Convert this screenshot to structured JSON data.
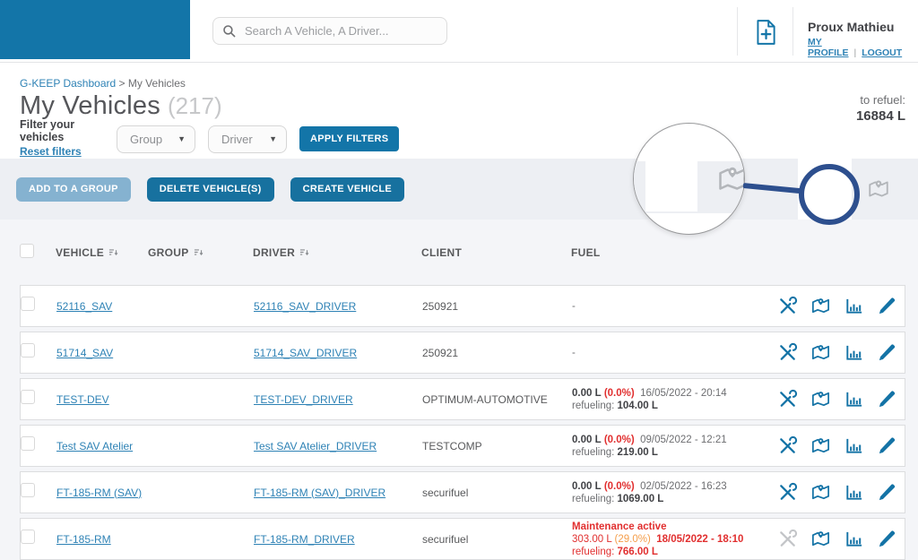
{
  "header": {
    "search_placeholder": "Search A Vehicle, A Driver...",
    "user_name": "Proux Mathieu",
    "my_profile": "MY PROFILE",
    "divider": "|",
    "logout": "LOGOUT"
  },
  "breadcrumb": {
    "home": "G-KEEP Dashboard",
    "rest": " > My Vehicles"
  },
  "page": {
    "title": "My Vehicles",
    "count": "(217)",
    "to_refuel_label": "to refuel:",
    "to_refuel_value": "16884 L"
  },
  "filters": {
    "label": "Filter your vehicles",
    "reset": "Reset filters",
    "group": "Group",
    "driver": "Driver",
    "dropdown_arrow": "▼",
    "apply": "APPLY FILTERS"
  },
  "toolbar": {
    "add_group": "ADD TO A GROUP",
    "delete": "DELETE VEHICLE(S)",
    "create": "CREATE VEHICLE"
  },
  "table": {
    "headers": {
      "vehicle": "VEHICLE",
      "group": "GROUP",
      "driver": "DRIVER",
      "client": "CLIENT",
      "fuel": "FUEL"
    }
  },
  "rows": [
    {
      "vehicle": "52116_SAV",
      "group": "",
      "driver": "52116_SAV_DRIVER",
      "client": "250921",
      "fuel": {
        "dash": "-"
      }
    },
    {
      "vehicle": "51714_SAV",
      "group": "",
      "driver": "51714_SAV_DRIVER",
      "client": "250921",
      "fuel": {
        "dash": "-"
      }
    },
    {
      "vehicle": "TEST-DEV",
      "group": "",
      "driver": "TEST-DEV_DRIVER",
      "client": "OPTIMUM-AUTOMOTIVE",
      "fuel": {
        "amount": "0.00 L",
        "pct": "(0.0%)",
        "date": "16/05/2022 - 20:14",
        "refuel_label": "refueling:",
        "refuel_value": "104.00 L"
      }
    },
    {
      "vehicle": "Test SAV Atelier",
      "group": "",
      "driver": "Test SAV Atelier_DRIVER",
      "client": "TESTCOMP",
      "fuel": {
        "amount": "0.00 L",
        "pct": "(0.0%)",
        "date": "09/05/2022 - 12:21",
        "refuel_label": "refueling:",
        "refuel_value": "219.00 L"
      }
    },
    {
      "vehicle": "FT-185-RM (SAV)",
      "group": "",
      "driver": "FT-185-RM (SAV)_DRIVER",
      "client": "securifuel",
      "fuel": {
        "amount": "0.00 L",
        "pct": "(0.0%)",
        "date": "02/05/2022 - 16:23",
        "refuel_label": "refueling:",
        "refuel_value": "1069.00 L"
      }
    },
    {
      "vehicle": "FT-185-RM",
      "group": "",
      "driver": "FT-185-RM_DRIVER",
      "client": "securifuel",
      "fuel": {
        "maintenance": "Maintenance active",
        "amount": "303.00 L",
        "pct": "(29.0%)",
        "date": "18/05/2022 - 18:10",
        "refuel_label": "refueling:",
        "refuel_value": "766.00 L"
      }
    }
  ],
  "icons": {
    "search": "magnifier-icon",
    "file_plus": "new-document-icon",
    "sort": "sort-icon",
    "list_view": "list-view-icon",
    "map_view": "map-view-icon",
    "row_tools": "maintenance-tools-icon",
    "row_map": "map-pin-icon",
    "row_chart": "bar-chart-icon",
    "row_edit": "pencil-icon"
  },
  "colors": {
    "primary_blue": "#1375a8",
    "disabled_blue": "#85b2d0",
    "link_blue": "#2e82b5",
    "annotation_navy": "#2d4f8e",
    "alert_red": "#e12f2f",
    "warn_orange": "#f59e4b",
    "band_gray": "#edeff3"
  }
}
